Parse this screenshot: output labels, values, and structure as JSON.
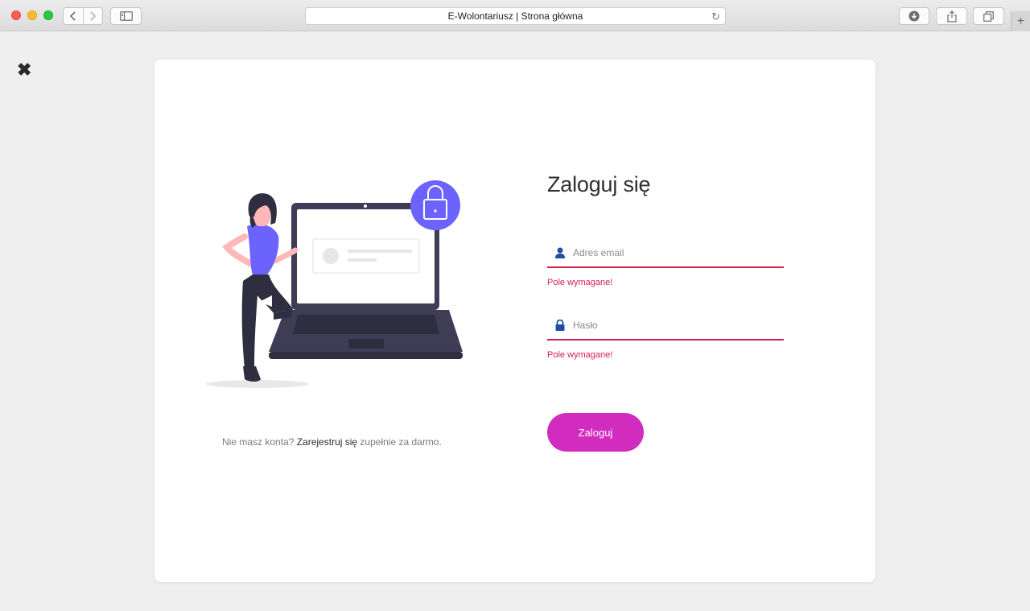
{
  "browser": {
    "tab_title": "E-Wolontariusz | Strona główna"
  },
  "login": {
    "title": "Zaloguj się",
    "email": {
      "placeholder": "Adres email",
      "value": "",
      "error": "Pole wymagane!"
    },
    "password": {
      "placeholder": "Hasło",
      "value": "",
      "error": "Pole wymagane!"
    },
    "submit_label": "Zaloguj"
  },
  "register": {
    "prefix": "Nie masz konta?",
    "link": "Zarejestruj się",
    "suffix": "zupełnie za darmo."
  },
  "colors": {
    "accent": "#d12cbe",
    "error": "#d6204e",
    "illustration_purple": "#6c63ff",
    "icon_blue": "#1f4fa3"
  }
}
